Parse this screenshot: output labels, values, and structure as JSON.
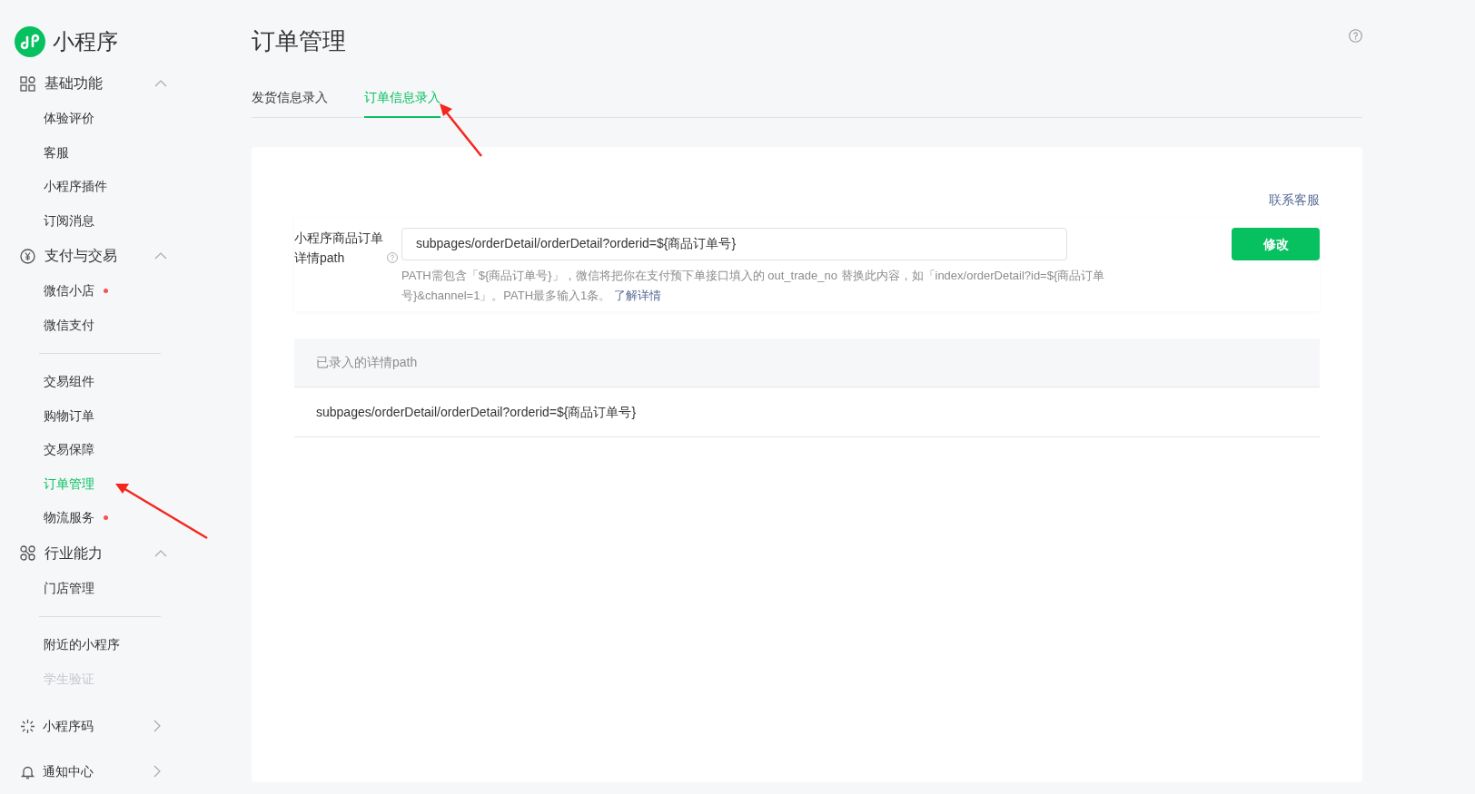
{
  "app": {
    "name": "小程序"
  },
  "sidebar": {
    "groups": [
      {
        "title": "基础功能",
        "expanded": true,
        "items": [
          {
            "kind": "link",
            "label": "体验评价",
            "selected": false,
            "dot": false
          },
          {
            "kind": "link",
            "label": "客服",
            "selected": false,
            "dot": false
          },
          {
            "kind": "link",
            "label": "小程序插件",
            "selected": false,
            "dot": false
          },
          {
            "kind": "link",
            "label": "订阅消息",
            "selected": false,
            "dot": false
          }
        ]
      },
      {
        "title": "支付与交易",
        "expanded": true,
        "items": [
          {
            "kind": "link",
            "label": "微信小店",
            "selected": false,
            "dot": true
          },
          {
            "kind": "link",
            "label": "微信支付",
            "selected": false,
            "dot": false
          },
          {
            "kind": "divider"
          },
          {
            "kind": "link",
            "label": "交易组件",
            "selected": false,
            "dot": false
          },
          {
            "kind": "link",
            "label": "购物订单",
            "selected": false,
            "dot": false
          },
          {
            "kind": "link",
            "label": "交易保障",
            "selected": false,
            "dot": false
          },
          {
            "kind": "link",
            "label": "订单管理",
            "selected": true,
            "dot": false
          },
          {
            "kind": "link",
            "label": "物流服务",
            "selected": false,
            "dot": true
          }
        ]
      },
      {
        "title": "行业能力",
        "expanded": true,
        "items": [
          {
            "kind": "link",
            "label": "门店管理",
            "selected": false,
            "dot": false
          },
          {
            "kind": "divider"
          },
          {
            "kind": "link",
            "label": "附近的小程序",
            "selected": false,
            "dot": false
          },
          {
            "kind": "faded",
            "label": "学生验证",
            "selected": false,
            "dot": false
          }
        ]
      }
    ],
    "footer": [
      {
        "label": "小程序码"
      },
      {
        "label": "通知中心"
      }
    ]
  },
  "page": {
    "title": "订单管理",
    "tabs": [
      {
        "label": "发货信息录入",
        "selected": false
      },
      {
        "label": "订单信息录入",
        "selected": true
      }
    ],
    "card": {
      "contact_link": "联系客服",
      "form": {
        "label": "小程序商品订单详情path",
        "value": "subpages/orderDetail/orderDetail?orderid=${商品订单号}",
        "hint": "PATH需包含「${商品订单号}」，微信将把你在支付预下单接口填入的 out_trade_no 替换此内容，如「index/orderDetail?id=${商品订单号}&channel=1」。PATH最多输入1条。",
        "hint_link": "了解详情",
        "button": "修改"
      },
      "table": {
        "columns": [
          "已录入的详情path"
        ],
        "rows": [
          [
            "subpages/orderDetail/orderDetail?orderid=${商品订单号}"
          ]
        ]
      }
    }
  }
}
